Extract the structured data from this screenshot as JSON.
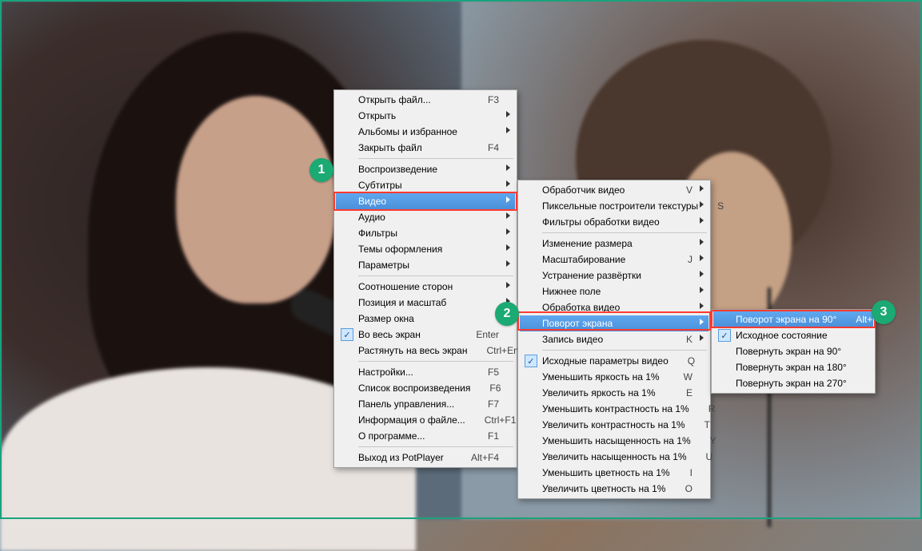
{
  "annotations": {
    "badge1": "1",
    "badge2": "2",
    "badge3": "3"
  },
  "menu1": {
    "g1": [
      {
        "label": "Открыть файл...",
        "accel": "F3"
      },
      {
        "label": "Открыть",
        "submenu": true
      },
      {
        "label": "Альбомы и избранное",
        "submenu": true
      },
      {
        "label": "Закрыть файл",
        "accel": "F4"
      }
    ],
    "g2": [
      {
        "label": "Воспроизведение",
        "submenu": true
      },
      {
        "label": "Субтитры",
        "submenu": true
      },
      {
        "label": "Видео",
        "submenu": true,
        "highlight": true
      },
      {
        "label": "Аудио",
        "submenu": true
      },
      {
        "label": "Фильтры",
        "submenu": true
      },
      {
        "label": "Темы оформления",
        "submenu": true
      },
      {
        "label": "Параметры",
        "submenu": true
      }
    ],
    "g3": [
      {
        "label": "Соотношение сторон",
        "submenu": true
      },
      {
        "label": "Позиция и масштаб",
        "submenu": true
      },
      {
        "label": "Размер окна",
        "submenu": true
      },
      {
        "label": "Во весь экран",
        "accel": "Enter",
        "checked": true
      },
      {
        "label": "Растянуть на весь экран",
        "accel": "Ctrl+Enter"
      }
    ],
    "g4": [
      {
        "label": "Настройки...",
        "accel": "F5"
      },
      {
        "label": "Список воспроизведения",
        "accel": "F6"
      },
      {
        "label": "Панель управления...",
        "accel": "F7"
      },
      {
        "label": "Информация о файле...",
        "accel": "Ctrl+F1"
      },
      {
        "label": "О программе...",
        "accel": "F1"
      }
    ],
    "g5": [
      {
        "label": "Выход из PotPlayer",
        "accel": "Alt+F4"
      }
    ]
  },
  "menu2": {
    "g1": [
      {
        "label": "Обработчик видео",
        "accel": "V",
        "submenu": true
      },
      {
        "label": "Пиксельные построители текстуры",
        "accel": "S",
        "submenu": true
      },
      {
        "label": "Фильтры обработки видео",
        "submenu": true
      }
    ],
    "g2": [
      {
        "label": "Изменение размера",
        "submenu": true
      },
      {
        "label": "Масштабирование",
        "accel": "J",
        "submenu": true
      },
      {
        "label": "Устранение развёртки",
        "submenu": true
      },
      {
        "label": "Нижнее поле",
        "submenu": true
      },
      {
        "label": "Обработка видео",
        "submenu": true
      },
      {
        "label": "Поворот экрана",
        "submenu": true,
        "highlight": true
      },
      {
        "label": "Запись видео",
        "accel": "K",
        "submenu": true
      }
    ],
    "g3": [
      {
        "label": "Исходные параметры видео",
        "accel": "Q",
        "checked": true
      },
      {
        "label": "Уменьшить яркость на 1%",
        "accel": "W"
      },
      {
        "label": "Увеличить яркость на 1%",
        "accel": "E"
      },
      {
        "label": "Уменьшить контрастность на 1%",
        "accel": "R"
      },
      {
        "label": "Увеличить контрастность на 1%",
        "accel": "T"
      },
      {
        "label": "Уменьшить насыщенность на 1%",
        "accel": "Y"
      },
      {
        "label": "Увеличить насыщенность на 1%",
        "accel": "U"
      },
      {
        "label": "Уменьшить цветность на 1%",
        "accel": "I"
      },
      {
        "label": "Увеличить цветность на 1%",
        "accel": "O"
      }
    ]
  },
  "menu3": {
    "g1": [
      {
        "label": "Поворот экрана на 90°",
        "accel": "Alt+K",
        "highlight": true
      },
      {
        "label": "Исходное состояние",
        "checked": true
      },
      {
        "label": "Повернуть экран на 90°"
      },
      {
        "label": "Повернуть экран на 180°"
      },
      {
        "label": "Повернуть экран на 270°"
      }
    ]
  }
}
